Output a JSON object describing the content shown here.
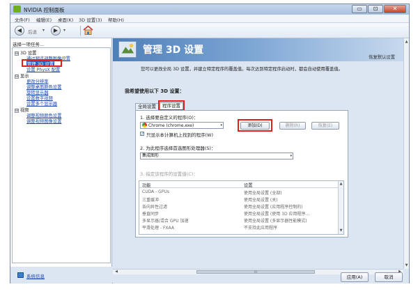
{
  "window": {
    "title": "NVIDIA 控制面板",
    "controls": [
      "▭",
      "⊡",
      "✕"
    ]
  },
  "menu": [
    "文件(F)",
    "编辑(E)",
    "桌面(K)",
    "3D 设置(3)",
    "帮助(H)"
  ],
  "toolbar": {
    "back_label": "后退",
    "back_glyph": "◀",
    "forward_glyph": "▶",
    "dropdown_glyph": "▾"
  },
  "left": {
    "heading": "选择一项任务...",
    "tree": [
      {
        "label": "3D 设置",
        "kind": "group",
        "exp": "⊟"
      },
      {
        "label": "通过预览调整图像设置",
        "kind": "link"
      },
      {
        "label": "管理 3D 设置",
        "kind": "selected"
      },
      {
        "label": "设置 PhysX 配置",
        "kind": "link"
      },
      {
        "label": "显示",
        "kind": "group",
        "exp": "⊟"
      },
      {
        "label": "更改分辨率",
        "kind": "link"
      },
      {
        "label": "调整桌面颜色设置",
        "kind": "link"
      },
      {
        "label": "旋转显示器",
        "kind": "link"
      },
      {
        "label": "设置数字视频",
        "kind": "link"
      },
      {
        "label": "设置多个显示器",
        "kind": "link"
      },
      {
        "label": "视频",
        "kind": "group",
        "exp": "⊟"
      },
      {
        "label": "调整视频颜色设置",
        "kind": "link"
      },
      {
        "label": "调整视频图像设置",
        "kind": "link"
      }
    ],
    "system_info": "系统信息"
  },
  "main": {
    "title": "管理 3D 设置",
    "restore_defaults": "恢复默认设置",
    "description": "您可以更改全局 3D 设置，并建立特定程序的覆盖值。每次达到特定程序启动时，都会自动使用覆盖值。",
    "section_title": "我希望使用以下 3D 设置：",
    "tabs": [
      {
        "label": "全局设置",
        "active": false
      },
      {
        "label": "程序设置",
        "active": true
      }
    ],
    "step1_label": "1. 选择要自定义的程序(O)：",
    "program_value": "Chrome (chrome.exe)",
    "add_button": "添加(D)",
    "remove_button": "删除(R)",
    "restore_button": "恢复(E)",
    "only_show_checkbox": "只显示本计算机上找到的程序(W)",
    "only_show_checked": true,
    "step2_label": "2. 为此程序选择首选图形处理器(S)：",
    "gpu_value": "集成图形",
    "step3_label": "3. 指定该程序的设置值(C)：",
    "table": {
      "headers": [
        "功能",
        "设置"
      ],
      "rows": [
        [
          "CUDA - GPUs",
          "使用全局设置 (全部)"
        ],
        [
          "三重缓冲",
          "使用全局设置 (关)"
        ],
        [
          "各向异性过滤",
          "使用全局设置 (应用程序控制的)"
        ],
        [
          "垂直同步",
          "使用全局设置 (使用 3D 应用程序..."
        ],
        [
          "多显示器/混合 GPU 加速",
          "使用全局设置 (多显示器性能模式)"
        ],
        [
          "平滑处理 - FXAA",
          "不支持此应用程序"
        ]
      ]
    },
    "scroll_thumb_grip": "III"
  },
  "footer": {
    "apply": "应用(A)",
    "cancel": "取消"
  },
  "colors": {
    "highlight": "#e0201c",
    "selection": "#2b63c4",
    "banner": "#4f7fb8",
    "nvidia_green": "#6fae1d"
  }
}
